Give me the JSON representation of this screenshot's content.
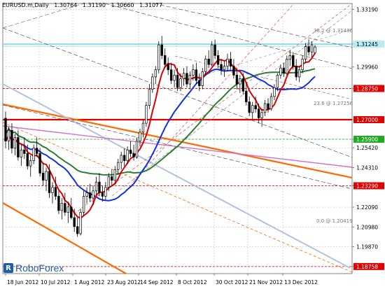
{
  "header": {
    "symbol": "EURUSD.m,Daily",
    "open": "1.30764",
    "high": "1.31190",
    "low": "1.30660",
    "close": "1.31077"
  },
  "logo": {
    "text": "RoboForex"
  },
  "colors": {
    "background": "#ffffff",
    "grid": "#c8c8c8",
    "bull_candle": "#ffffff",
    "bear_candle": "#000000",
    "ma_red": "#e00000",
    "ma_blue": "#1030e0",
    "ma_green": "#2e7d32",
    "ma_magenta": "#d070d0",
    "support_red": "#e00000",
    "trend_orange": "#ff6a00",
    "trend_lightblue": "#b0c4de",
    "fib_red": "#e00000",
    "fib_gray": "#777777",
    "price_box_cyan": "#b8ecf5",
    "price_box_red": "#e00000",
    "price_box_green": "#22aa22"
  },
  "chart_data": {
    "type": "candlestick",
    "instrument": "EURUSD.m",
    "timeframe": "Daily",
    "x_labels": [
      "18 Jun 2012",
      "10 Jul 2012",
      "1 Aug 2012",
      "23 Aug 2012",
      "14 Sep 2012",
      "8 Oct 2012",
      "30 Oct 2012",
      "21 Nov 2012",
      "13 Dec 2012"
    ],
    "y_labels": [
      "1.33190",
      "1.31245",
      "1.29960",
      "1.28750",
      "1.27000",
      "1.25900",
      "1.25420",
      "1.24310",
      "1.23290",
      "1.22090",
      "1.20980",
      "1.19870",
      "1.18758"
    ],
    "ylim": [
      1.1836,
      1.3352
    ],
    "price_markers": [
      {
        "value": 1.31245,
        "label": "1.31245",
        "style": "cyan"
      },
      {
        "value": 1.2875,
        "label": "1.28750",
        "style": "red"
      },
      {
        "value": 1.27,
        "label": "1.27000",
        "style": "red"
      },
      {
        "value": 1.259,
        "label": "1.25900",
        "style": "green"
      },
      {
        "value": 1.2329,
        "label": "1.23290",
        "style": "red"
      },
      {
        "value": 1.18758,
        "label": "1.18758",
        "style": "red"
      }
    ],
    "fib_levels": [
      {
        "label": "38.2 @ 1.31486",
        "value": 1.31486
      },
      {
        "label": "23.6 @ 1.27256",
        "value": 1.27256
      },
      {
        "label": "0.0 @ 1.20419",
        "value": 1.20419
      }
    ],
    "candles": [
      {
        "o": 1.2708,
        "h": 1.2745,
        "l": 1.254,
        "c": 1.258
      },
      {
        "o": 1.258,
        "h": 1.266,
        "l": 1.253,
        "c": 1.264
      },
      {
        "o": 1.264,
        "h": 1.268,
        "l": 1.251,
        "c": 1.254
      },
      {
        "o": 1.254,
        "h": 1.262,
        "l": 1.25,
        "c": 1.26
      },
      {
        "o": 1.26,
        "h": 1.264,
        "l": 1.247,
        "c": 1.249
      },
      {
        "o": 1.249,
        "h": 1.256,
        "l": 1.244,
        "c": 1.253
      },
      {
        "o": 1.253,
        "h": 1.26,
        "l": 1.248,
        "c": 1.251
      },
      {
        "o": 1.251,
        "h": 1.256,
        "l": 1.242,
        "c": 1.244
      },
      {
        "o": 1.244,
        "h": 1.25,
        "l": 1.238,
        "c": 1.247
      },
      {
        "o": 1.247,
        "h": 1.256,
        "l": 1.245,
        "c": 1.254
      },
      {
        "o": 1.254,
        "h": 1.26,
        "l": 1.249,
        "c": 1.251
      },
      {
        "o": 1.251,
        "h": 1.254,
        "l": 1.238,
        "c": 1.24
      },
      {
        "o": 1.24,
        "h": 1.246,
        "l": 1.233,
        "c": 1.236
      },
      {
        "o": 1.236,
        "h": 1.243,
        "l": 1.23,
        "c": 1.241
      },
      {
        "o": 1.241,
        "h": 1.245,
        "l": 1.226,
        "c": 1.229
      },
      {
        "o": 1.229,
        "h": 1.235,
        "l": 1.223,
        "c": 1.232
      },
      {
        "o": 1.232,
        "h": 1.238,
        "l": 1.225,
        "c": 1.227
      },
      {
        "o": 1.227,
        "h": 1.23,
        "l": 1.217,
        "c": 1.219
      },
      {
        "o": 1.219,
        "h": 1.226,
        "l": 1.214,
        "c": 1.223
      },
      {
        "o": 1.223,
        "h": 1.229,
        "l": 1.216,
        "c": 1.218
      },
      {
        "o": 1.218,
        "h": 1.224,
        "l": 1.212,
        "c": 1.221
      },
      {
        "o": 1.221,
        "h": 1.226,
        "l": 1.214,
        "c": 1.215
      },
      {
        "o": 1.215,
        "h": 1.22,
        "l": 1.207,
        "c": 1.21
      },
      {
        "o": 1.21,
        "h": 1.215,
        "l": 1.2042,
        "c": 1.206
      },
      {
        "o": 1.206,
        "h": 1.22,
        "l": 1.205,
        "c": 1.218
      },
      {
        "o": 1.218,
        "h": 1.23,
        "l": 1.216,
        "c": 1.227
      },
      {
        "o": 1.227,
        "h": 1.232,
        "l": 1.223,
        "c": 1.229
      },
      {
        "o": 1.229,
        "h": 1.234,
        "l": 1.224,
        "c": 1.226
      },
      {
        "o": 1.226,
        "h": 1.233,
        "l": 1.222,
        "c": 1.23
      },
      {
        "o": 1.23,
        "h": 1.238,
        "l": 1.228,
        "c": 1.235
      },
      {
        "o": 1.235,
        "h": 1.24,
        "l": 1.227,
        "c": 1.229
      },
      {
        "o": 1.229,
        "h": 1.233,
        "l": 1.224,
        "c": 1.227
      },
      {
        "o": 1.227,
        "h": 1.235,
        "l": 1.225,
        "c": 1.232
      },
      {
        "o": 1.232,
        "h": 1.24,
        "l": 1.23,
        "c": 1.238
      },
      {
        "o": 1.238,
        "h": 1.242,
        "l": 1.233,
        "c": 1.236
      },
      {
        "o": 1.236,
        "h": 1.244,
        "l": 1.234,
        "c": 1.242
      },
      {
        "o": 1.242,
        "h": 1.248,
        "l": 1.239,
        "c": 1.246
      },
      {
        "o": 1.246,
        "h": 1.252,
        "l": 1.242,
        "c": 1.25
      },
      {
        "o": 1.25,
        "h": 1.254,
        "l": 1.244,
        "c": 1.247
      },
      {
        "o": 1.247,
        "h": 1.255,
        "l": 1.245,
        "c": 1.253
      },
      {
        "o": 1.253,
        "h": 1.258,
        "l": 1.249,
        "c": 1.251
      },
      {
        "o": 1.251,
        "h": 1.256,
        "l": 1.247,
        "c": 1.249
      },
      {
        "o": 1.249,
        "h": 1.26,
        "l": 1.248,
        "c": 1.258
      },
      {
        "o": 1.258,
        "h": 1.265,
        "l": 1.255,
        "c": 1.263
      },
      {
        "o": 1.263,
        "h": 1.27,
        "l": 1.26,
        "c": 1.268
      },
      {
        "o": 1.268,
        "h": 1.28,
        "l": 1.266,
        "c": 1.278
      },
      {
        "o": 1.278,
        "h": 1.29,
        "l": 1.276,
        "c": 1.287
      },
      {
        "o": 1.287,
        "h": 1.296,
        "l": 1.285,
        "c": 1.294
      },
      {
        "o": 1.294,
        "h": 1.3,
        "l": 1.29,
        "c": 1.298
      },
      {
        "o": 1.298,
        "h": 1.314,
        "l": 1.296,
        "c": 1.312
      },
      {
        "o": 1.312,
        "h": 1.317,
        "l": 1.304,
        "c": 1.306
      },
      {
        "o": 1.306,
        "h": 1.31,
        "l": 1.299,
        "c": 1.301
      },
      {
        "o": 1.301,
        "h": 1.305,
        "l": 1.295,
        "c": 1.298
      },
      {
        "o": 1.298,
        "h": 1.302,
        "l": 1.29,
        "c": 1.292
      },
      {
        "o": 1.292,
        "h": 1.298,
        "l": 1.288,
        "c": 1.295
      },
      {
        "o": 1.295,
        "h": 1.299,
        "l": 1.286,
        "c": 1.288
      },
      {
        "o": 1.288,
        "h": 1.296,
        "l": 1.286,
        "c": 1.293
      },
      {
        "o": 1.293,
        "h": 1.299,
        "l": 1.289,
        "c": 1.296
      },
      {
        "o": 1.296,
        "h": 1.3,
        "l": 1.288,
        "c": 1.29
      },
      {
        "o": 1.29,
        "h": 1.297,
        "l": 1.287,
        "c": 1.295
      },
      {
        "o": 1.295,
        "h": 1.301,
        "l": 1.292,
        "c": 1.298
      },
      {
        "o": 1.298,
        "h": 1.302,
        "l": 1.29,
        "c": 1.292
      },
      {
        "o": 1.292,
        "h": 1.296,
        "l": 1.286,
        "c": 1.289
      },
      {
        "o": 1.289,
        "h": 1.299,
        "l": 1.287,
        "c": 1.297
      },
      {
        "o": 1.297,
        "h": 1.306,
        "l": 1.295,
        "c": 1.304
      },
      {
        "o": 1.304,
        "h": 1.309,
        "l": 1.299,
        "c": 1.301
      },
      {
        "o": 1.301,
        "h": 1.314,
        "l": 1.3,
        "c": 1.312
      },
      {
        "o": 1.312,
        "h": 1.315,
        "l": 1.304,
        "c": 1.306
      },
      {
        "o": 1.306,
        "h": 1.309,
        "l": 1.299,
        "c": 1.301
      },
      {
        "o": 1.301,
        "h": 1.304,
        "l": 1.295,
        "c": 1.298
      },
      {
        "o": 1.298,
        "h": 1.303,
        "l": 1.294,
        "c": 1.3
      },
      {
        "o": 1.3,
        "h": 1.307,
        "l": 1.297,
        "c": 1.304
      },
      {
        "o": 1.304,
        "h": 1.308,
        "l": 1.298,
        "c": 1.3
      },
      {
        "o": 1.3,
        "h": 1.304,
        "l": 1.293,
        "c": 1.295
      },
      {
        "o": 1.295,
        "h": 1.299,
        "l": 1.287,
        "c": 1.29
      },
      {
        "o": 1.29,
        "h": 1.295,
        "l": 1.285,
        "c": 1.293
      },
      {
        "o": 1.293,
        "h": 1.296,
        "l": 1.284,
        "c": 1.286
      },
      {
        "o": 1.286,
        "h": 1.291,
        "l": 1.278,
        "c": 1.28
      },
      {
        "o": 1.28,
        "h": 1.283,
        "l": 1.272,
        "c": 1.274
      },
      {
        "o": 1.274,
        "h": 1.28,
        "l": 1.27,
        "c": 1.278
      },
      {
        "o": 1.278,
        "h": 1.283,
        "l": 1.274,
        "c": 1.276
      },
      {
        "o": 1.276,
        "h": 1.279,
        "l": 1.268,
        "c": 1.271
      },
      {
        "o": 1.271,
        "h": 1.276,
        "l": 1.266,
        "c": 1.274
      },
      {
        "o": 1.274,
        "h": 1.281,
        "l": 1.272,
        "c": 1.279
      },
      {
        "o": 1.279,
        "h": 1.282,
        "l": 1.274,
        "c": 1.276
      },
      {
        "o": 1.276,
        "h": 1.285,
        "l": 1.275,
        "c": 1.283
      },
      {
        "o": 1.283,
        "h": 1.29,
        "l": 1.281,
        "c": 1.288
      },
      {
        "o": 1.288,
        "h": 1.296,
        "l": 1.286,
        "c": 1.295
      },
      {
        "o": 1.295,
        "h": 1.301,
        "l": 1.293,
        "c": 1.299
      },
      {
        "o": 1.299,
        "h": 1.302,
        "l": 1.294,
        "c": 1.296
      },
      {
        "o": 1.296,
        "h": 1.306,
        "l": 1.295,
        "c": 1.304
      },
      {
        "o": 1.304,
        "h": 1.309,
        "l": 1.3,
        "c": 1.306
      },
      {
        "o": 1.306,
        "h": 1.308,
        "l": 1.298,
        "c": 1.3
      },
      {
        "o": 1.3,
        "h": 1.304,
        "l": 1.292,
        "c": 1.294
      },
      {
        "o": 1.294,
        "h": 1.3,
        "l": 1.291,
        "c": 1.298
      },
      {
        "o": 1.298,
        "h": 1.306,
        "l": 1.296,
        "c": 1.304
      },
      {
        "o": 1.304,
        "h": 1.313,
        "l": 1.302,
        "c": 1.311
      },
      {
        "o": 1.311,
        "h": 1.315,
        "l": 1.306,
        "c": 1.308
      },
      {
        "o": 1.308,
        "h": 1.314,
        "l": 1.305,
        "c": 1.312
      },
      {
        "o": 1.30764,
        "h": 1.3119,
        "l": 1.3066,
        "c": 1.31077
      }
    ]
  }
}
